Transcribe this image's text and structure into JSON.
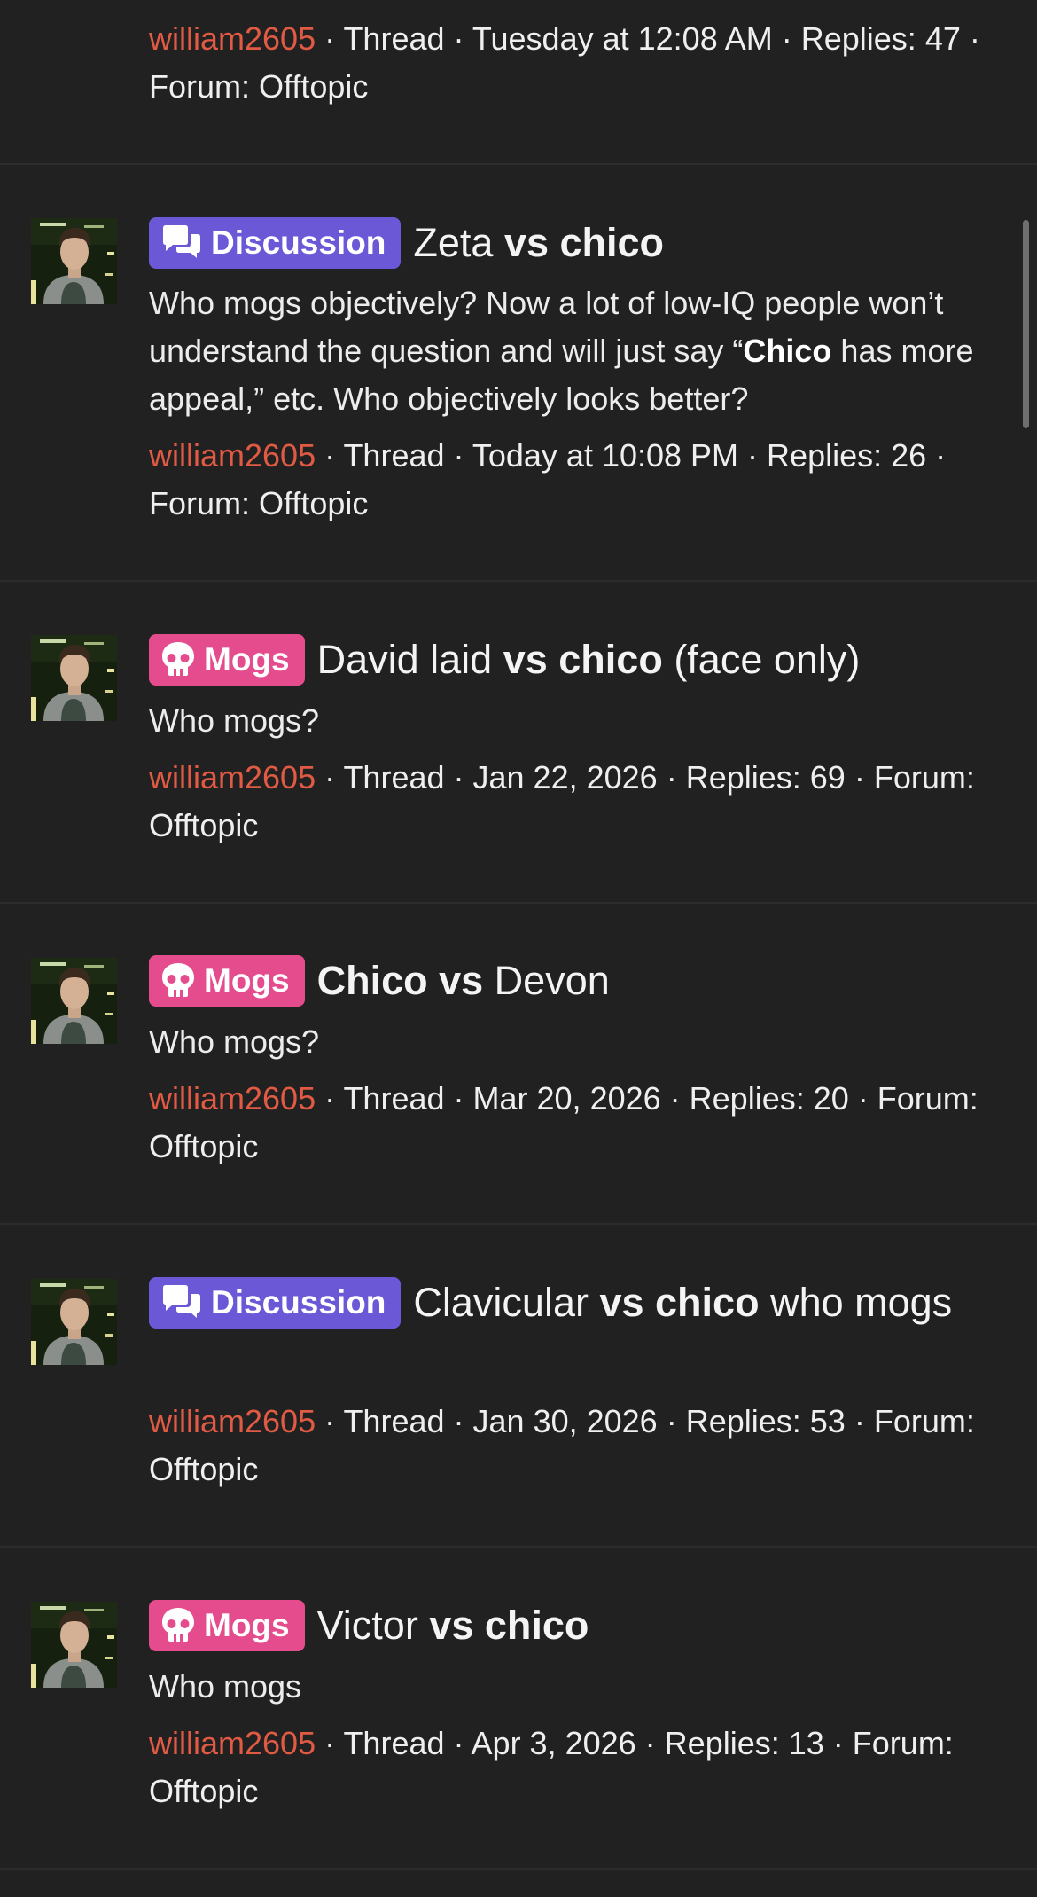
{
  "labels": {
    "thread": "Thread",
    "replies": "Replies:",
    "forum": "Forum:",
    "sep": " · "
  },
  "colors": {
    "background": "#212121",
    "username": "#e05a44",
    "badge_discussion": "#6a58d6",
    "badge_mogs": "#e44c8e"
  },
  "icons": {
    "discussion": "chat-bubbles-icon",
    "mogs": "skull-icon"
  },
  "top_partial": {
    "author": "william2605",
    "type": "Thread",
    "date": "Tuesday at 12:08 AM",
    "replies": "47",
    "forum": "Offtopic"
  },
  "results": [
    {
      "badge": "Discussion",
      "title_parts": [
        {
          "text": "Zeta ",
          "bold": false
        },
        {
          "text": "vs chico",
          "bold": true
        }
      ],
      "snippet_parts": [
        {
          "text": "Who mogs objectively? Now a lot of low-IQ people won’t understand the question and will just say “",
          "bold": false
        },
        {
          "text": "Chico",
          "bold": true
        },
        {
          "text": " has more appeal,” etc. Who objectively looks better?",
          "bold": false
        }
      ],
      "author": "william2605",
      "type": "Thread",
      "date": "Today at 10:08 PM",
      "replies": "26",
      "forum": "Offtopic"
    },
    {
      "badge": "Mogs",
      "title_parts": [
        {
          "text": "David laid ",
          "bold": false
        },
        {
          "text": "vs chico",
          "bold": true
        },
        {
          "text": " (face only)",
          "bold": false
        }
      ],
      "snippet_parts": [
        {
          "text": "Who mogs?",
          "bold": false
        }
      ],
      "author": "william2605",
      "type": "Thread",
      "date": "Jan 22, 2026",
      "replies": "69",
      "forum": "Offtopic"
    },
    {
      "badge": "Mogs",
      "title_parts": [
        {
          "text": "Chico vs",
          "bold": true
        },
        {
          "text": " Devon",
          "bold": false
        }
      ],
      "snippet_parts": [
        {
          "text": "Who mogs?",
          "bold": false
        }
      ],
      "author": "william2605",
      "type": "Thread",
      "date": "Mar 20, 2026",
      "replies": "20",
      "forum": "Offtopic"
    },
    {
      "badge": "Discussion",
      "title_parts": [
        {
          "text": "Clavicular ",
          "bold": false
        },
        {
          "text": "vs chico",
          "bold": true
        },
        {
          "text": " who mogs",
          "bold": false
        }
      ],
      "snippet_parts": [],
      "author": "william2605",
      "type": "Thread",
      "date": "Jan 30, 2026",
      "replies": "53",
      "forum": "Offtopic"
    },
    {
      "badge": "Mogs",
      "title_parts": [
        {
          "text": "Victor ",
          "bold": false
        },
        {
          "text": "vs chico",
          "bold": true
        }
      ],
      "snippet_parts": [
        {
          "text": "Who mogs",
          "bold": false
        }
      ],
      "author": "william2605",
      "type": "Thread",
      "date": "Apr 3, 2026",
      "replies": "13",
      "forum": "Offtopic"
    }
  ]
}
